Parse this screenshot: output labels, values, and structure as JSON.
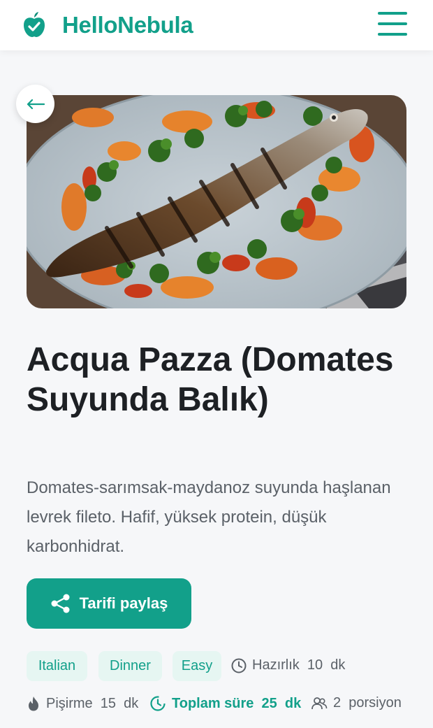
{
  "header": {
    "brand": "HelloNebula",
    "menu_icon": "hamburger-menu-icon",
    "logo_icon": "apple-check-icon"
  },
  "recipe": {
    "title": "Acqua Pazza (Domates Suyunda Balık)",
    "description": "Domates-sarımsak-maydanoz suyunda haşlanan levrek fileto. Hafif, yüksek protein, düşük karbonhidrat.",
    "share_label": "Tarifi paylaş",
    "tags": [
      "Italian",
      "Dinner",
      "Easy"
    ],
    "prep": "Hazırlık  10  dk",
    "cook": "Pişirme  15  dk",
    "total": "Toplam süre  25  dk",
    "servings": "2  porsiyon"
  },
  "colors": {
    "accent": "#12a08a",
    "tag_bg": "#e6f6f2",
    "page_bg": "#f6f7f9"
  }
}
